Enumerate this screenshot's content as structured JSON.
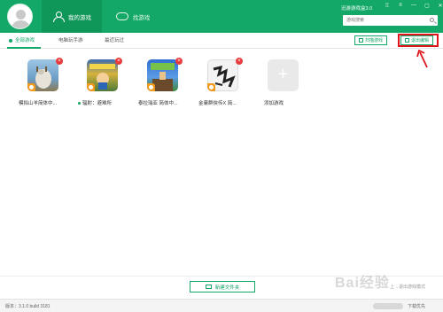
{
  "app": {
    "name": "迅游游戏盒3.0"
  },
  "header": {
    "tabs": [
      {
        "label": "我的游戏",
        "icon": "user-icon",
        "active": true
      },
      {
        "label": "找游戏",
        "icon": "gamepad-icon",
        "active": false
      }
    ],
    "window_controls": [
      "shirt-icon",
      "menu-icon",
      "minimize-icon",
      "maximize-icon",
      "close-icon"
    ],
    "search": {
      "placeholder": "游戏搜索"
    }
  },
  "subtabs": [
    {
      "label": "全部游戏",
      "active": true
    },
    {
      "label": "电脑玩手游",
      "active": false
    },
    {
      "label": "最近玩过",
      "active": false
    }
  ],
  "actions": {
    "scan_label": "扫描游戏",
    "edit_label": "退出编辑"
  },
  "games": [
    {
      "name": "模拟山羊简体中...",
      "accelerated": true,
      "has_dot": false,
      "thumb_color": "#87b4d6"
    },
    {
      "name": "辐射：避难所",
      "accelerated": true,
      "has_dot": true,
      "thumb_color": "#d9b641"
    },
    {
      "name": "泰拉瑞亚 简体中...",
      "accelerated": true,
      "has_dot": false,
      "thumb_color": "#3b6fc4"
    },
    {
      "name": "金庸群侠传X 简...",
      "accelerated": true,
      "has_dot": false,
      "thumb_color": "#f2f2f2"
    }
  ],
  "add_game": {
    "label": "添加游戏"
  },
  "footer": {
    "new_folder_label": "新建文件夹",
    "version": "版本：3.1.0 build 3181",
    "download_priority": "下载优先",
    "mode_label": "上→退出游戏模式",
    "watermark": "Bai经验"
  },
  "colors": {
    "brand": "#13a867",
    "highlight": "#e1141b",
    "close_badge": "#e63c3c",
    "accel_badge": "#f39a1c"
  }
}
